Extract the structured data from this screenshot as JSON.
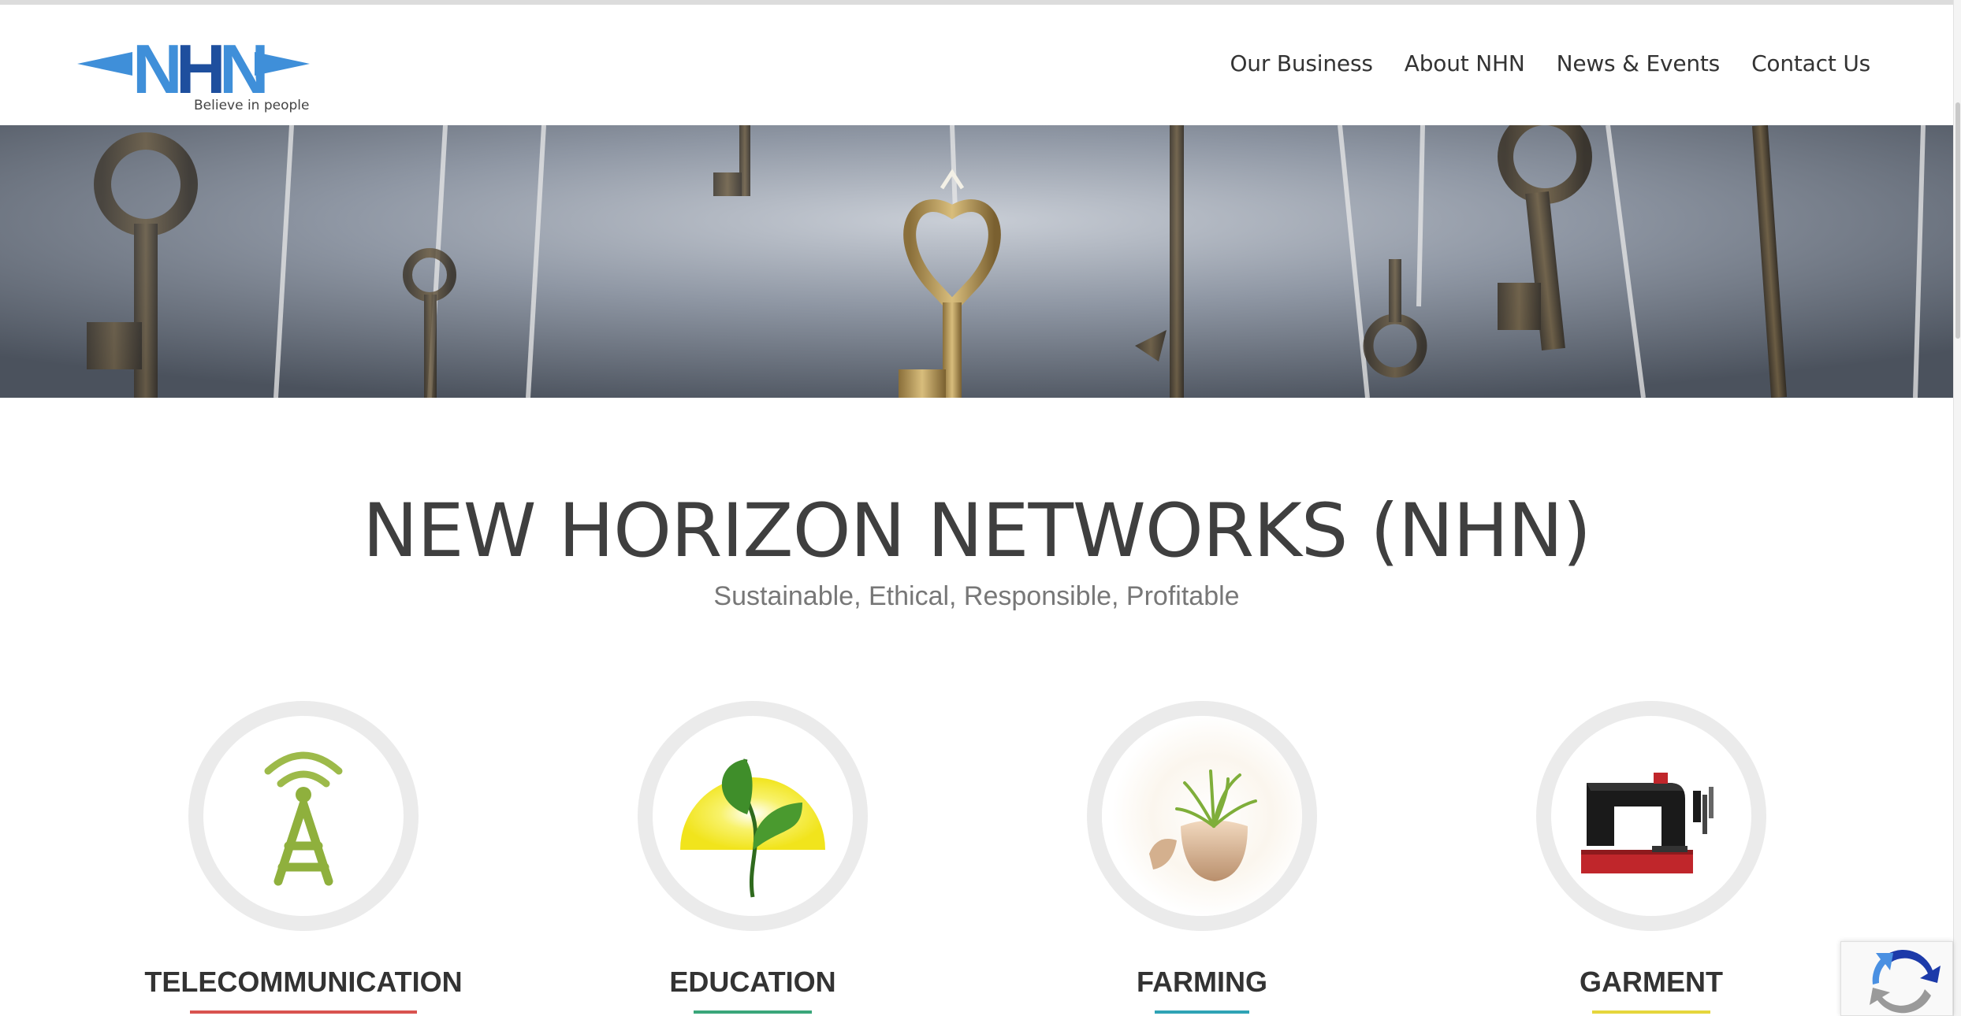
{
  "logo": {
    "text": "NHN",
    "tagline": "Believe in people",
    "colors": {
      "dark": "#1e4f9e",
      "light": "#3f8fd9"
    }
  },
  "nav": {
    "items": [
      {
        "label": "Our Business"
      },
      {
        "label": "About NHN"
      },
      {
        "label": "News & Events"
      },
      {
        "label": "Contact Us"
      }
    ]
  },
  "hero": {
    "image": "keys-hanging-banner"
  },
  "main": {
    "title": "NEW HORIZON NETWORKS (NHN)",
    "subtitle": "Sustainable, Ethical, Responsible, Profitable"
  },
  "businesses": [
    {
      "label": "TELECOMMUNICATION",
      "icon": "antenna-tower-icon",
      "accent": "#d9534f"
    },
    {
      "label": "EDUCATION",
      "icon": "sprouting-plant-icon",
      "accent": "#3aa67a"
    },
    {
      "label": "FARMING",
      "icon": "plant-in-eggshell-icon",
      "accent": "#2fa3b5"
    },
    {
      "label": "GARMENT",
      "icon": "sewing-machine-icon",
      "accent": "#e5d63c"
    }
  ],
  "recaptcha": {
    "icon": "recaptcha-icon"
  }
}
